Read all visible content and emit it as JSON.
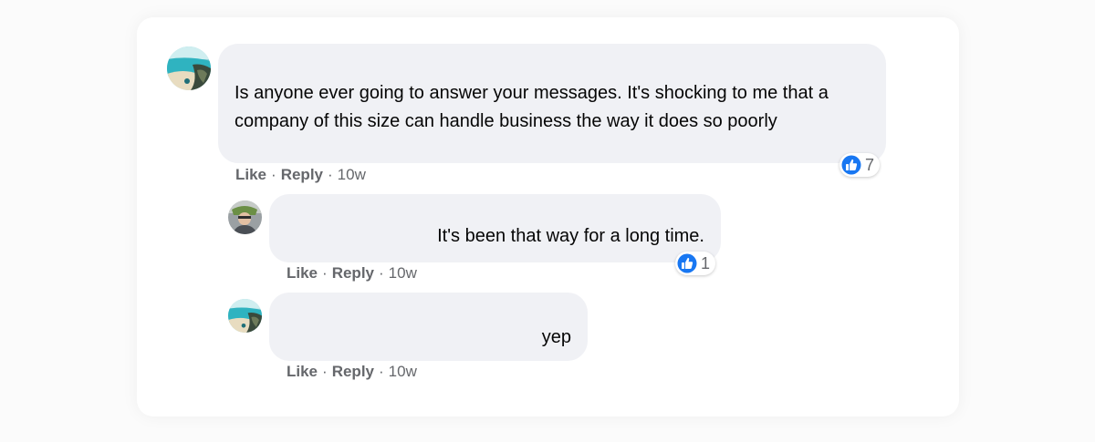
{
  "colors": {
    "bubble": "#f0f1f5",
    "text": "#050505",
    "meta": "#65676b",
    "like_blue": "#1877f2"
  },
  "comments": [
    {
      "avatar_icon": "beach-photo-avatar",
      "text": "Is anyone ever going to answer your messages. It's shocking to me that a company of this size can handle business the way it does so poorly",
      "like_label": "Like",
      "reply_label": "Reply",
      "separator": "·",
      "time": "10w",
      "reaction_icon": "thumbs-up-icon",
      "reaction_count": "7"
    },
    {
      "avatar_icon": "person-photo-avatar",
      "text": "It's been that way for a long time.",
      "like_label": "Like",
      "reply_label": "Reply",
      "separator": "·",
      "time": "10w",
      "reaction_icon": "thumbs-up-icon",
      "reaction_count": "1"
    },
    {
      "avatar_icon": "beach-photo-avatar",
      "text": "yep",
      "like_label": "Like",
      "reply_label": "Reply",
      "separator": "·",
      "time": "10w"
    }
  ]
}
